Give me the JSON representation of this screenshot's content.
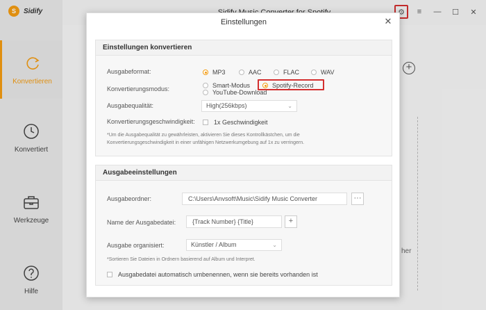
{
  "brand": {
    "name": "Sidify",
    "logo_letter": "S"
  },
  "window": {
    "title": "Sidify Music Converter for Spotify",
    "menu_glyph": "≡",
    "min_glyph": "—",
    "max_glyph": "☐",
    "close_glyph": "✕",
    "gear_glyph": "⚙"
  },
  "nav": [
    {
      "label": "Konvertieren",
      "icon": "refresh-icon"
    },
    {
      "label": "Konvertiert",
      "icon": "clock-icon"
    },
    {
      "label": "Werkzeuge",
      "icon": "toolbox-icon"
    },
    {
      "label": "Hilfe",
      "icon": "help-icon"
    }
  ],
  "background": {
    "plus": "+",
    "partial_text": "her"
  },
  "dialog": {
    "title": "Einstellungen",
    "close": "✕",
    "convert": {
      "heading": "Einstellungen konvertieren",
      "format_label": "Ausgabeformat:",
      "formats": [
        "MP3",
        "AAC",
        "FLAC",
        "WAV"
      ],
      "selected_format": "MP3",
      "mode_label": "Konvertierungsmodus:",
      "modes": [
        "Smart-Modus",
        "YouTube-Download",
        "Spotify-Record"
      ],
      "selected_mode": "Spotify-Record",
      "quality_label": "Ausgabequalität:",
      "quality_value": "High(256kbps)",
      "speed_label": "Konvertierungsgeschwindigkeit:",
      "speed_option": "1x Geschwindigkeit",
      "note": "*Um die Ausgabequalität zu gewährleisten, aktivieren Sie dieses Kontrollkästchen, um die Konvertierungsgeschwindigkeit in einer unfähigen Netzwerkumgebung auf 1x zu verringern."
    },
    "output": {
      "heading": "Ausgabeeinstellungen",
      "folder_label": "Ausgabeordner:",
      "folder_value": "C:\\Users\\Anvsoft\\Music\\Sidify Music Converter",
      "browse": "···",
      "filename_label": "Name der Ausgabedatei:",
      "filename_value": "{Track Number} {Title}",
      "add": "+",
      "organize_label": "Ausgabe organisiert:",
      "organize_value": "Künstler / Album",
      "organize_note": "*Sortieren Sie Dateien in Ordnern basierend auf Album und Interpret.",
      "rename_label": "Ausgabedatei automatisch umbenennen, wenn sie bereits vorhanden ist"
    }
  },
  "colors": {
    "accent": "#f39c12",
    "highlight": "#d32f2f"
  }
}
